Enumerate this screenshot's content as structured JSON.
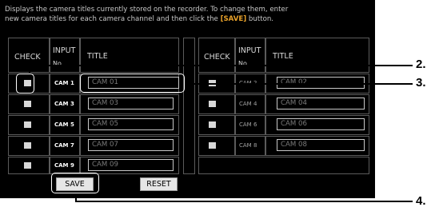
{
  "instructions": {
    "line1": "Displays the camera titles currently stored on the recorder. To change them, enter",
    "line2_a": "new camera titles for each camera channel and then click the ",
    "line2_b": "[SAVE]",
    "line2_c": " button."
  },
  "columns": {
    "check": "CHECK",
    "input": "INPUT",
    "input_sub": "No.",
    "title": "TITLE"
  },
  "left_rows": [
    {
      "cam": "CAM 1",
      "title": "CAM 01"
    },
    {
      "cam": "CAM 3",
      "title": "CAM 03"
    },
    {
      "cam": "CAM 5",
      "title": "CAM 05"
    },
    {
      "cam": "CAM 7",
      "title": "CAM 07"
    },
    {
      "cam": "CAM 9",
      "title": "CAM 09"
    }
  ],
  "right_rows": [
    {
      "cam": "CAM 2",
      "title": "CAM 02"
    },
    {
      "cam": "CAM 4",
      "title": "CAM 04"
    },
    {
      "cam": "CAM 6",
      "title": "CAM 06"
    },
    {
      "cam": "CAM 8",
      "title": "CAM 08"
    }
  ],
  "buttons": {
    "save": "SAVE",
    "reset": "RESET"
  },
  "callouts": {
    "c2": "2.",
    "c3": "3.",
    "c4": "4."
  }
}
